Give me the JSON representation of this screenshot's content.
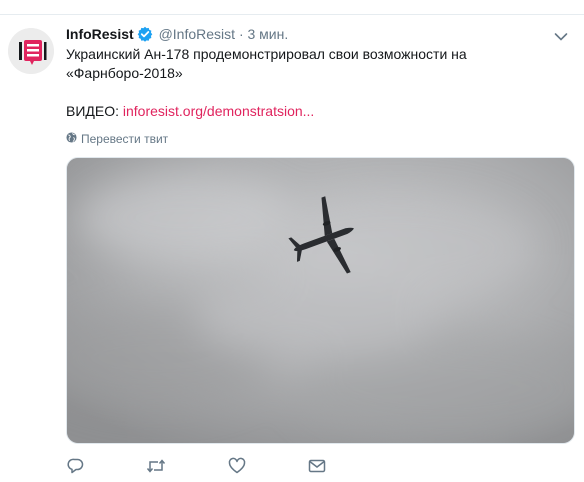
{
  "tweet": {
    "author_name": "InfoResist",
    "author_handle": "@InfoResist",
    "separator": "·",
    "time": "3 мин.",
    "text_line1": "Украинский Ан-178 продемонстрировал свои возможности на",
    "text_line2": "«Фарнборо-2018»",
    "video_label": "ВИДЕО: ",
    "video_link": "inforesist.org/demonstratsion...",
    "translate_label": "Перевести твит"
  },
  "icons": {
    "avatar": "inforesist-logo",
    "verified": "verified-badge-icon",
    "menu": "chevron-down-icon",
    "reply": "reply-icon",
    "retweet": "retweet-icon",
    "like": "heart-icon",
    "message": "envelope-icon",
    "translate": "globe-icon"
  },
  "colors": {
    "accent": "#e0245e",
    "verified": "#1da1f2",
    "secondary_text": "#657786",
    "logo_red": "#e0245e"
  }
}
